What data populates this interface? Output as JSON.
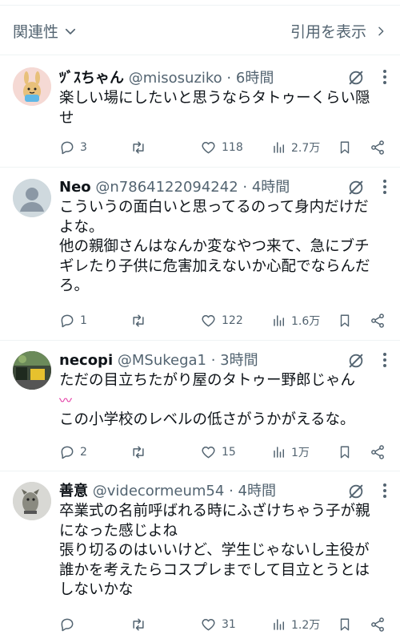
{
  "sortbar": {
    "left_label": "関連性",
    "right_label": "引用を表示"
  },
  "tweets": [
    {
      "name": "ﾂﾞｽちゃん",
      "handle": "@misosuziko",
      "time": "6時間",
      "lines": [
        "楽しい場にしたいと思うならタトゥーくらい隠",
        "せ"
      ],
      "replies": "3",
      "likes": "118",
      "views": "2.7万"
    },
    {
      "name": "Neo",
      "handle": "@n7864122094242",
      "time": "4時間",
      "lines": [
        "こういうの面白いと思ってるのって身内だけだ",
        "よな。",
        "他の親御さんはなんか変なやつ来て、急にブチ",
        "ギレたり子供に危害加えないか心配でならんだ",
        "ろ。"
      ],
      "replies": "1",
      "likes": "122",
      "views": "1.6万"
    },
    {
      "name": "necopi",
      "handle": "@MSukega1",
      "time": "3時間",
      "lines": [
        "ただの目立ちたがり屋のタトゥー野郎じゃん",
        "〰",
        "この小学校のレベルの低さがうかがえるな。"
      ],
      "replies": "2",
      "likes": "15",
      "views": "1万"
    },
    {
      "name": "善意",
      "handle": "@videcormeum54",
      "time": "4時間",
      "lines": [
        "卒業式の名前呼ばれる時にふざけちゃう子が親",
        "になった感じよね",
        "張り切るのはいいけど、学生じゃないし主役が",
        "誰かを考えたらコスプレまでして目立とうとは",
        "しないかな"
      ],
      "replies": "",
      "likes": "31",
      "views": "1.2万"
    }
  ],
  "colors": {
    "text": "#0f1419",
    "secondary": "#536471",
    "divider": "#eff3f4",
    "emoji_accent": "#e0249a"
  },
  "icons": [
    "chevron-down-icon",
    "chevron-right-icon",
    "grok-icon",
    "more-icon",
    "reply-icon",
    "retweet-icon",
    "like-icon",
    "views-icon",
    "bookmark-icon",
    "share-icon"
  ]
}
